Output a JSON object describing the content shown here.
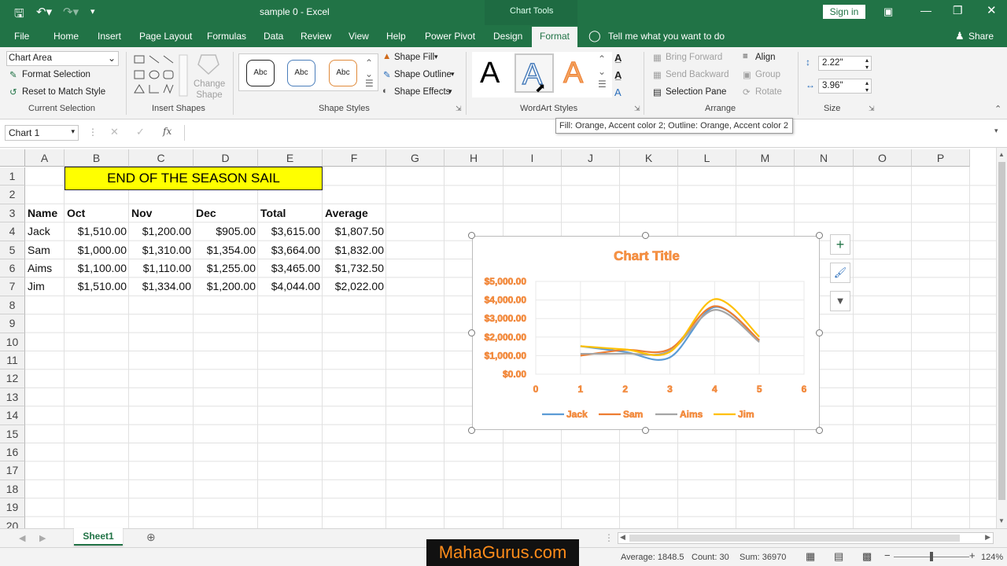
{
  "window": {
    "title": "sample 0  -  Excel",
    "context_tab": "Chart Tools",
    "signin": "Sign in"
  },
  "tabs": [
    "File",
    "Home",
    "Insert",
    "Page Layout",
    "Formulas",
    "Data",
    "Review",
    "View",
    "Help",
    "Power Pivot",
    "Design",
    "Format"
  ],
  "tell_me": "Tell me what you want to do",
  "share": "Share",
  "ribbon": {
    "current_selection": {
      "dropdown": "Chart Area",
      "format_selection": "Format Selection",
      "reset": "Reset to Match Style",
      "label": "Current Selection"
    },
    "insert_shapes": {
      "change_shape": "Change Shape",
      "label": "Insert Shapes"
    },
    "shape_styles": {
      "samples": [
        "Abc",
        "Abc",
        "Abc"
      ],
      "fill": "Shape Fill",
      "outline": "Shape Outline",
      "effects": "Shape Effects",
      "label": "Shape Styles"
    },
    "wordart": {
      "samples": [
        "A",
        "A",
        "A"
      ],
      "label": "WordArt Styles"
    },
    "arrange": {
      "bring_forward": "Bring Forward",
      "send_backward": "Send Backward",
      "selection_pane": "Selection Pane",
      "align": "Align",
      "group": "Group",
      "rotate": "Rotate",
      "label": "Arrange"
    },
    "size": {
      "height": "2.22\"",
      "width": "3.96\"",
      "label": "Size"
    }
  },
  "tooltip": "Fill: Orange, Accent color 2; Outline: Orange, Accent color 2",
  "formula_bar": {
    "name_box": "Chart 1",
    "fx": "fx",
    "value": ""
  },
  "columns": [
    "A",
    "B",
    "C",
    "D",
    "E",
    "F",
    "G",
    "H",
    "I",
    "J",
    "K",
    "L",
    "M",
    "N",
    "O",
    "P"
  ],
  "rows": [
    "1",
    "2",
    "3",
    "4",
    "5",
    "6",
    "7",
    "8",
    "9",
    "10",
    "11",
    "12",
    "13",
    "14",
    "15",
    "16",
    "17",
    "18",
    "19",
    "20"
  ],
  "sheet_title": "END OF THE SEASON SAIL",
  "table": {
    "headers": [
      "Name",
      "Oct",
      "Nov",
      "Dec",
      "Total",
      "Average"
    ],
    "rows": [
      [
        "Jack",
        "$1,510.00",
        "$1,200.00",
        "$905.00",
        "$3,615.00",
        "$1,807.50"
      ],
      [
        "Sam",
        "$1,000.00",
        "$1,310.00",
        "$1,354.00",
        "$3,664.00",
        "$1,832.00"
      ],
      [
        "Aims",
        "$1,100.00",
        "$1,110.00",
        "$1,255.00",
        "$3,465.00",
        "$1,732.50"
      ],
      [
        "Jim",
        "$1,510.00",
        "$1,334.00",
        "$1,200.00",
        "$4,044.00",
        "$2,022.00"
      ]
    ]
  },
  "chart_data": {
    "type": "scatter",
    "title": "Chart Title",
    "x": [
      1,
      2,
      3,
      4,
      5
    ],
    "series": [
      {
        "name": "Jack",
        "color": "#5b9bd5",
        "values": [
          1510,
          1200,
          905,
          3615,
          1807.5
        ]
      },
      {
        "name": "Sam",
        "color": "#ed7d31",
        "values": [
          1000,
          1310,
          1354,
          3664,
          1832
        ]
      },
      {
        "name": "Aims",
        "color": "#a5a5a5",
        "values": [
          1100,
          1110,
          1255,
          3465,
          1732.5
        ]
      },
      {
        "name": "Jim",
        "color": "#ffc000",
        "values": [
          1510,
          1334,
          1200,
          4044,
          2022
        ]
      }
    ],
    "xlim": [
      0,
      6
    ],
    "ylim": [
      0,
      5000
    ],
    "x_ticks": [
      "0",
      "1",
      "2",
      "3",
      "4",
      "5",
      "6"
    ],
    "y_ticks": [
      "$0.00",
      "$1,000.00",
      "$2,000.00",
      "$3,000.00",
      "$4,000.00",
      "$5,000.00"
    ],
    "grid": true,
    "legend": "bottom"
  },
  "sheet_tab": "Sheet1",
  "watermark": "MahaGurus.com",
  "status": {
    "average": "Average: 1848.5",
    "count": "Count: 30",
    "sum": "Sum: 36970",
    "zoom": "124%"
  }
}
